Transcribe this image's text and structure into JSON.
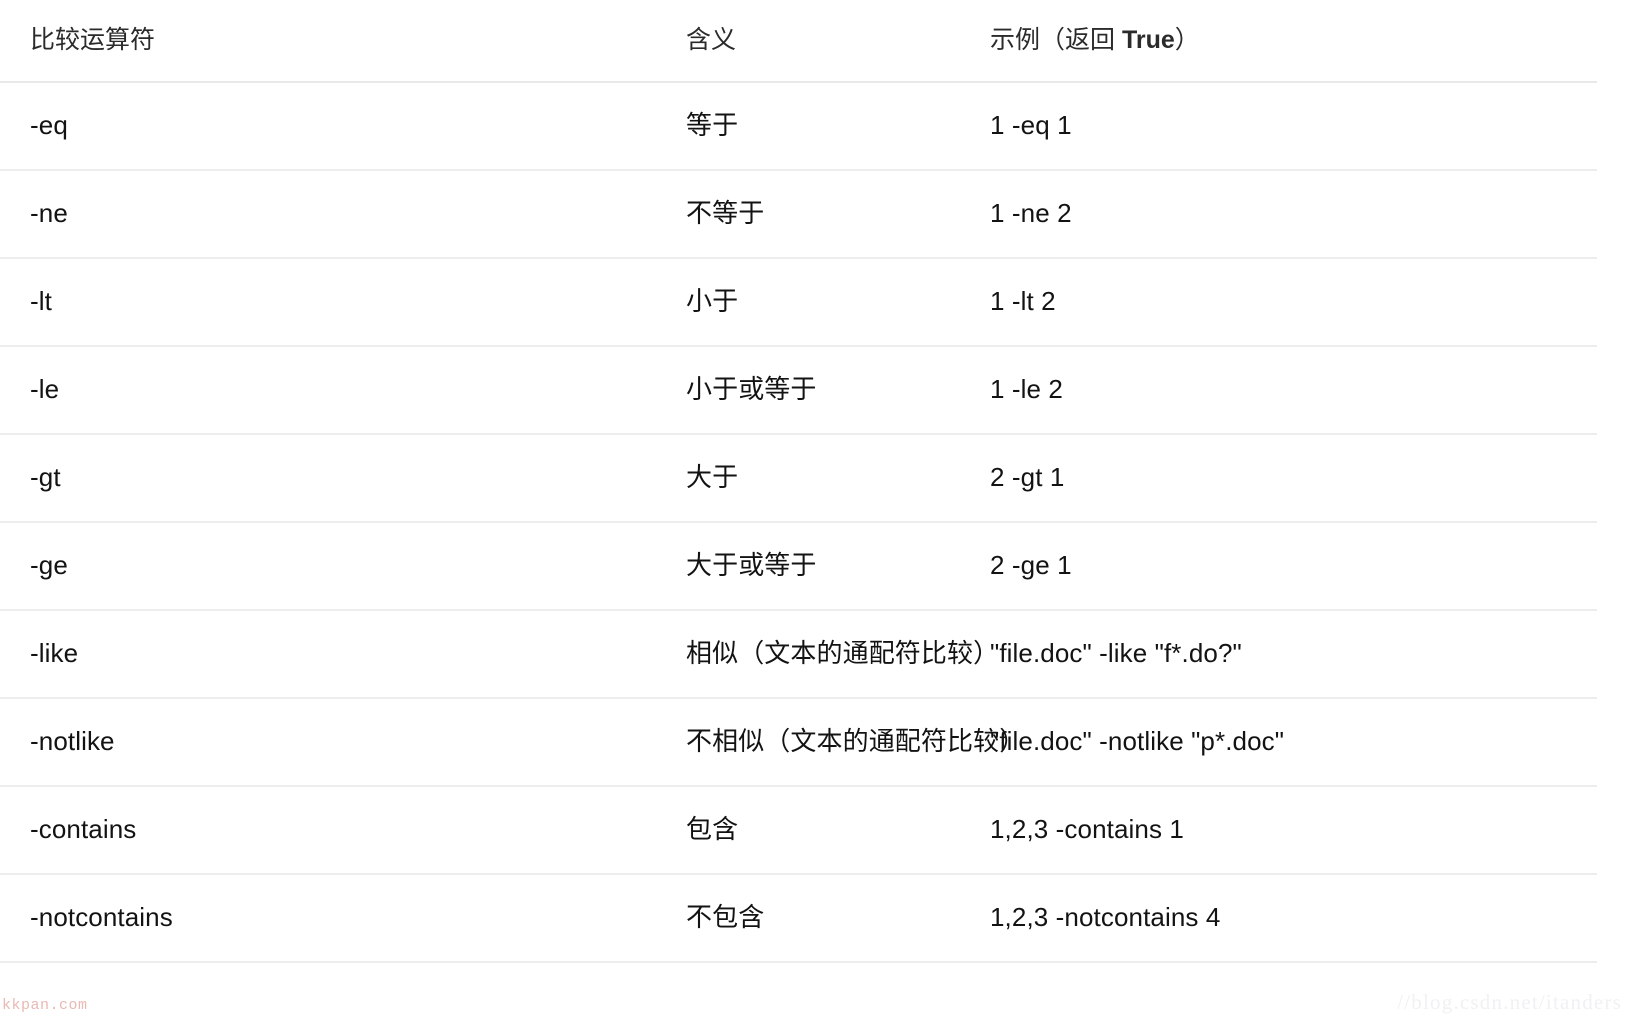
{
  "table": {
    "headers": {
      "operator": "比较运算符",
      "meaning": "含义",
      "example_prefix": "示例（返回 ",
      "example_true": "True",
      "example_suffix": "）"
    },
    "rows": [
      {
        "operator": "-eq",
        "meaning": "等于",
        "example": "1 -eq 1"
      },
      {
        "operator": "-ne",
        "meaning": "不等于",
        "example": "1 -ne 2"
      },
      {
        "operator": "-lt",
        "meaning": "小于",
        "example": "1 -lt 2"
      },
      {
        "operator": "-le",
        "meaning": "小于或等于",
        "example": "1 -le 2"
      },
      {
        "operator": "-gt",
        "meaning": "大于",
        "example": "2 -gt 1"
      },
      {
        "operator": "-ge",
        "meaning": "大于或等于",
        "example": "2 -ge 1"
      },
      {
        "operator": "-like",
        "meaning": "相似（文本的通配符比较）",
        "example": "\"file.doc\" -like \"f*.do?\""
      },
      {
        "operator": "-notlike",
        "meaning": "不相似（文本的通配符比较）",
        "example": "\"file.doc\" -notlike \"p*.doc\""
      },
      {
        "operator": "-contains",
        "meaning": "包含",
        "example": "1,2,3 -contains 1"
      },
      {
        "operator": "-notcontains",
        "meaning": "不包含",
        "example": "1,2,3 -notcontains 4"
      }
    ]
  },
  "watermarks": {
    "bottom_left": "kkpan.com",
    "bottom_right": "//blog.csdn.net/itanders"
  },
  "colors": {
    "page_background": "#ffffff",
    "text": "#131313",
    "header_text": "#2b2b2b",
    "row_border": "#ededed",
    "header_border": "#e9e9e9",
    "watermark_left": "#e9b9b4",
    "watermark_right": "#f1f1f3"
  }
}
